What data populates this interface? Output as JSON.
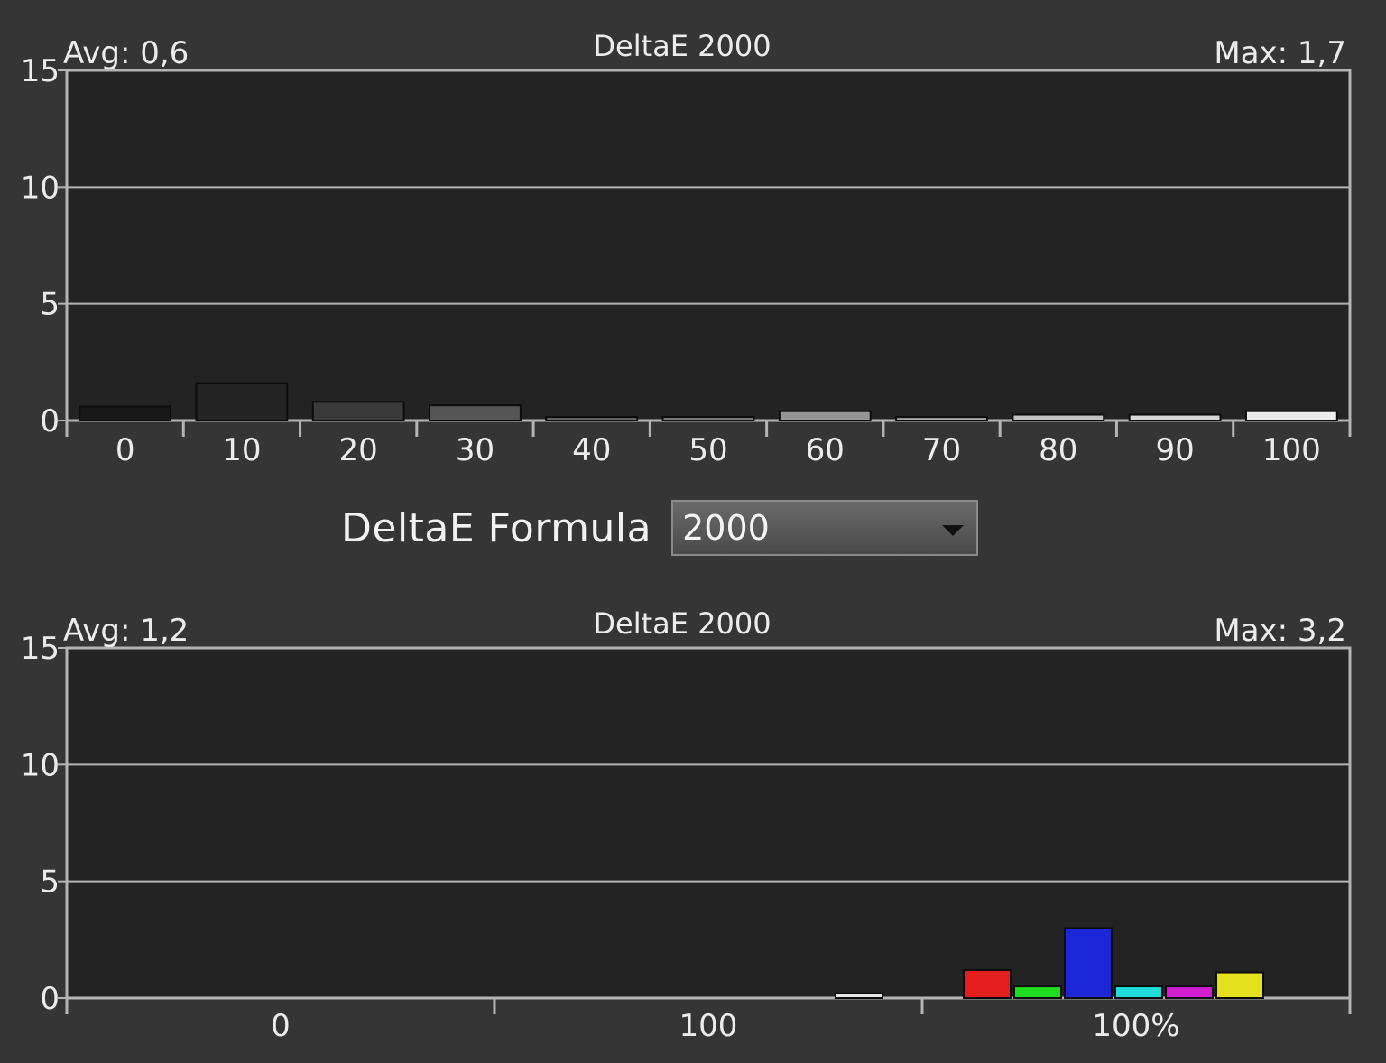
{
  "chart_data": [
    {
      "type": "bar",
      "title": "DeltaE 2000",
      "avg_label": "Avg: 0,6",
      "max_label": "Max: 1,7",
      "ylim": [
        0,
        15
      ],
      "yticks": [
        "0",
        "5",
        "10",
        "15"
      ],
      "grid": true,
      "categories": [
        "0",
        "10",
        "20",
        "30",
        "40",
        "50",
        "60",
        "70",
        "80",
        "90",
        "100"
      ],
      "values": [
        0.6,
        1.6,
        0.8,
        0.65,
        0.15,
        0.15,
        0.4,
        0.15,
        0.25,
        0.25,
        0.4
      ],
      "bar_colors": [
        "#181818",
        "#242424",
        "#3a3a3a",
        "#555555",
        "#6a6a6a",
        "#808080",
        "#959595",
        "#a8a8a8",
        "#c2c2c2",
        "#d6d6d6",
        "#ececec"
      ]
    },
    {
      "type": "bar",
      "title": "DeltaE 2000",
      "avg_label": "Avg: 1,2",
      "max_label": "Max: 3,2",
      "ylim": [
        0,
        15
      ],
      "yticks": [
        "0",
        "5",
        "10",
        "15"
      ],
      "grid": true,
      "group_labels": [
        "0",
        "100",
        "100%"
      ],
      "bars": [
        {
          "group": 1,
          "value": 0.2,
          "color": "#e8e8e8"
        },
        {
          "group": 2,
          "value": 1.2,
          "color": "#e41e1e"
        },
        {
          "group": 2,
          "value": 0.5,
          "color": "#1fdc1f"
        },
        {
          "group": 2,
          "value": 3.0,
          "color": "#1c28d8"
        },
        {
          "group": 2,
          "value": 0.5,
          "color": "#1edcdc"
        },
        {
          "group": 2,
          "value": 0.5,
          "color": "#d21ed2"
        },
        {
          "group": 2,
          "value": 1.1,
          "color": "#e4e01e"
        }
      ]
    }
  ],
  "formula": {
    "label": "DeltaE Formula",
    "value": "2000"
  },
  "colors": {
    "background": "#353535",
    "plot": "#232323",
    "grid": "#b4b4b4"
  }
}
